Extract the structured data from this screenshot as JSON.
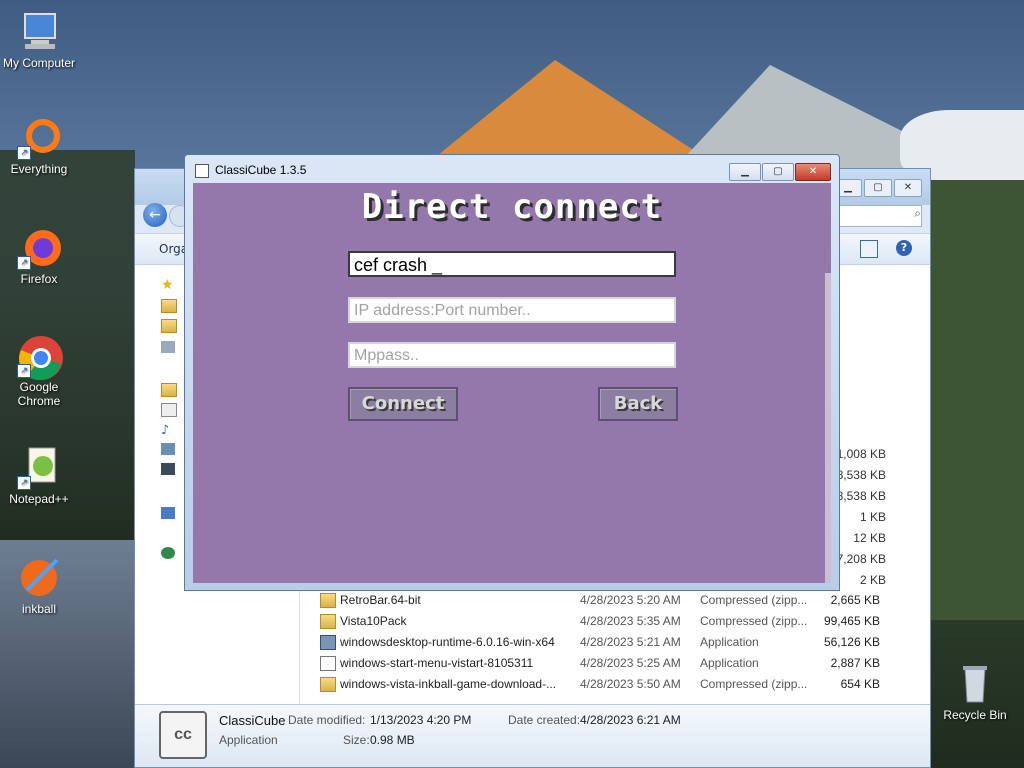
{
  "desktop": {
    "icons": [
      {
        "label": "My Computer"
      },
      {
        "label": "Everything"
      },
      {
        "label": "Firefox"
      },
      {
        "label": "Google Chrome"
      },
      {
        "label": "Notepad++"
      },
      {
        "label": "inkball"
      },
      {
        "label": "Recycle Bin"
      }
    ]
  },
  "explorer": {
    "organize_label": "Orga",
    "size_column": [
      "1,008 KB",
      "8,538 KB",
      "8,538 KB",
      "1 KB",
      "12 KB",
      "7,208 KB",
      "2 KB"
    ],
    "files": [
      {
        "name": "RetroBar.64-bit",
        "date": "4/28/2023 5:20 AM",
        "type": "Compressed (zipp...",
        "size": "2,665 KB",
        "icon": "zip-folder-icon"
      },
      {
        "name": "Vista10Pack",
        "date": "4/28/2023 5:35 AM",
        "type": "Compressed (zipp...",
        "size": "99,465 KB",
        "icon": "zip-folder-icon"
      },
      {
        "name": "windowsdesktop-runtime-6.0.16-win-x64",
        "date": "4/28/2023 5:21 AM",
        "type": "Application",
        "size": "56,126 KB",
        "icon": "installer-icon"
      },
      {
        "name": "windows-start-menu-vistart-8105311",
        "date": "4/28/2023 5:25 AM",
        "type": "Application",
        "size": "2,887 KB",
        "icon": "download-app-icon"
      },
      {
        "name": "windows-vista-inkball-game-download-...",
        "date": "4/28/2023 5:50 AM",
        "type": "Compressed (zipp...",
        "size": "654 KB",
        "icon": "zip-folder-icon"
      }
    ],
    "details": {
      "name": "ClassiCube",
      "type": "Application",
      "date_modified_label": "Date modified:",
      "date_modified": "1/13/2023 4:20 PM",
      "date_created_label": "Date created:",
      "date_created": "4/28/2023 6:21 AM",
      "size_label": "Size:",
      "size": "0.98 MB"
    }
  },
  "classicube": {
    "title": "ClassiCube 1.3.5",
    "heading": "Direct connect",
    "username_value": "cef crash _",
    "ip_placeholder": "IP address:Port number..",
    "mppass_placeholder": "Mppass..",
    "connect_label": "Connect",
    "back_label": "Back",
    "colors": {
      "background": "#9478ab",
      "button": "#8c7ea0"
    }
  }
}
